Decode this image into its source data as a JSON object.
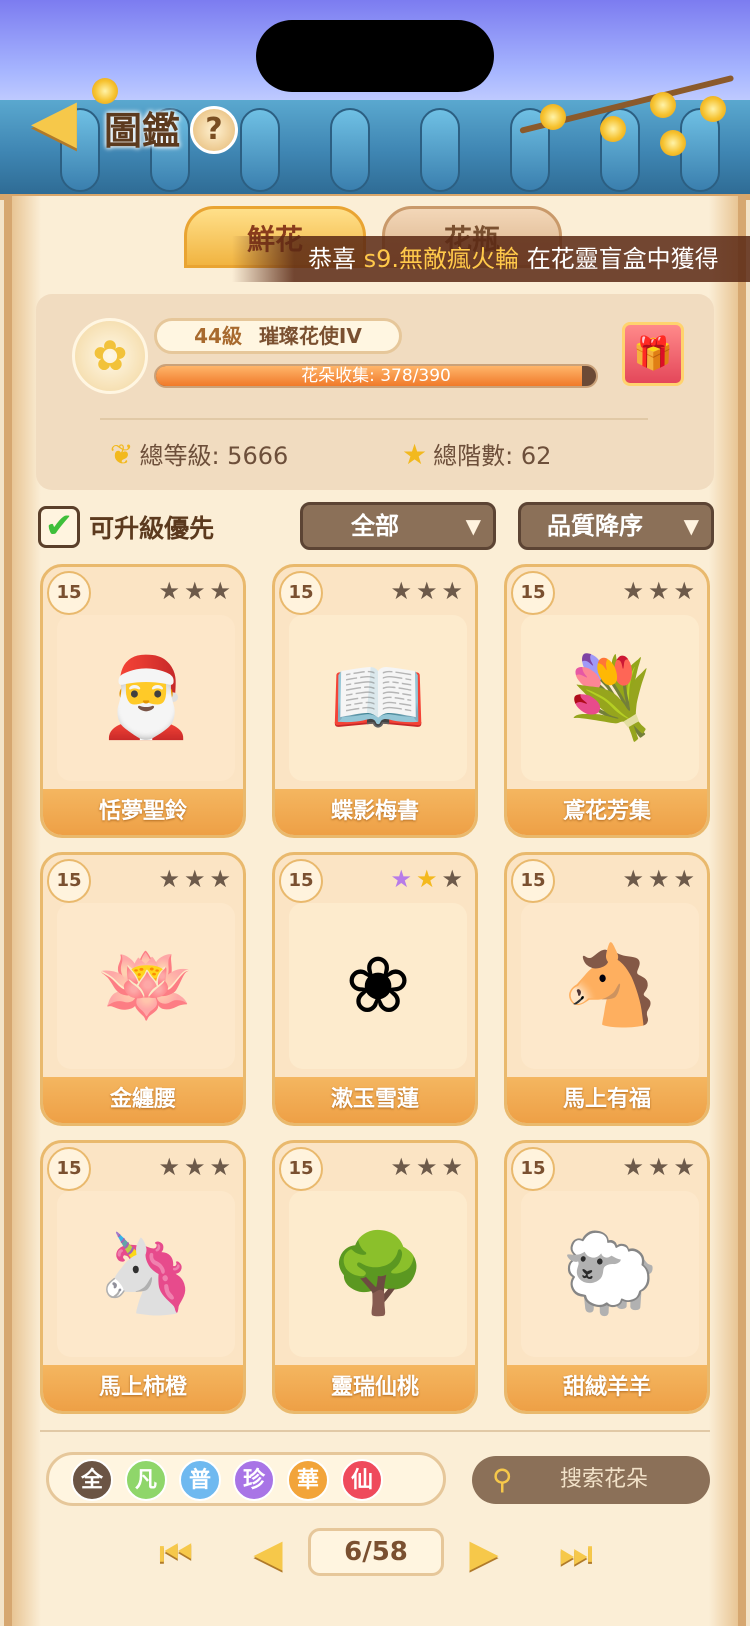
{
  "header": {
    "title": "圖鑑",
    "back_icon": "back-arrow-icon",
    "help_label": "?"
  },
  "tabs": [
    {
      "label": "鮮花"
    },
    {
      "label": "花瓶"
    }
  ],
  "marquee": {
    "prefix": "恭喜",
    "highlight": "s9.無敵瘋火輪",
    "suffix": "在花靈盲盒中獲得"
  },
  "player": {
    "level": "44級",
    "rank": "璀璨花使IV",
    "collection_text": "花朵收集: 378/390",
    "collection_fraction": 0.969,
    "total_level_label": "總等級: 5666",
    "total_stars_label": "總階數: 62"
  },
  "filters": {
    "upgrade_first_label": "可升級優先",
    "category": "全部",
    "sort": "品質降序"
  },
  "cards": [
    {
      "level": "15",
      "name": "恬夢聖鈴",
      "stars": [
        "dark",
        "dark",
        "dark"
      ],
      "art": "🎅",
      "bg": "#fde7c9"
    },
    {
      "level": "15",
      "name": "蝶影梅書",
      "stars": [
        "dark",
        "dark",
        "dark"
      ],
      "art": "📖",
      "bg": "#fdebcd"
    },
    {
      "level": "15",
      "name": "鳶花芳集",
      "stars": [
        "dark",
        "dark",
        "dark"
      ],
      "art": "💐",
      "bg": "#fdebcd"
    },
    {
      "level": "15",
      "name": "金纏腰",
      "stars": [
        "dark",
        "dark",
        "dark"
      ],
      "art": "🪷",
      "bg": "#fde8cb"
    },
    {
      "level": "15",
      "name": "漱玉雪蓮",
      "stars": [
        "purple",
        "gold",
        "dark"
      ],
      "art": "❀",
      "bg": "#fdebcd"
    },
    {
      "level": "15",
      "name": "馬上有福",
      "stars": [
        "dark",
        "dark",
        "dark"
      ],
      "art": "🐴",
      "bg": "#fde8cb"
    },
    {
      "level": "15",
      "name": "馬上柿橙",
      "stars": [
        "dark",
        "dark",
        "dark"
      ],
      "art": "🦄",
      "bg": "#fde8cb"
    },
    {
      "level": "15",
      "name": "靈瑞仙桃",
      "stars": [
        "dark",
        "dark",
        "dark"
      ],
      "art": "🌳",
      "bg": "#fdebcd"
    },
    {
      "level": "15",
      "name": "甜絨羊羊",
      "stars": [
        "dark",
        "dark",
        "dark"
      ],
      "art": "🐑",
      "bg": "#fde8cb"
    }
  ],
  "quality_chips": [
    {
      "label": "全",
      "color": "#6b5444"
    },
    {
      "label": "凡",
      "color": "#8fd66a"
    },
    {
      "label": "普",
      "color": "#6fb9f0"
    },
    {
      "label": "珍",
      "color": "#a874e6"
    },
    {
      "label": "華",
      "color": "#f2a43a"
    },
    {
      "label": "仙",
      "color": "#ef4a5c"
    }
  ],
  "search": {
    "placeholder": "搜索花朵"
  },
  "pager": {
    "page_label": "6/58"
  }
}
